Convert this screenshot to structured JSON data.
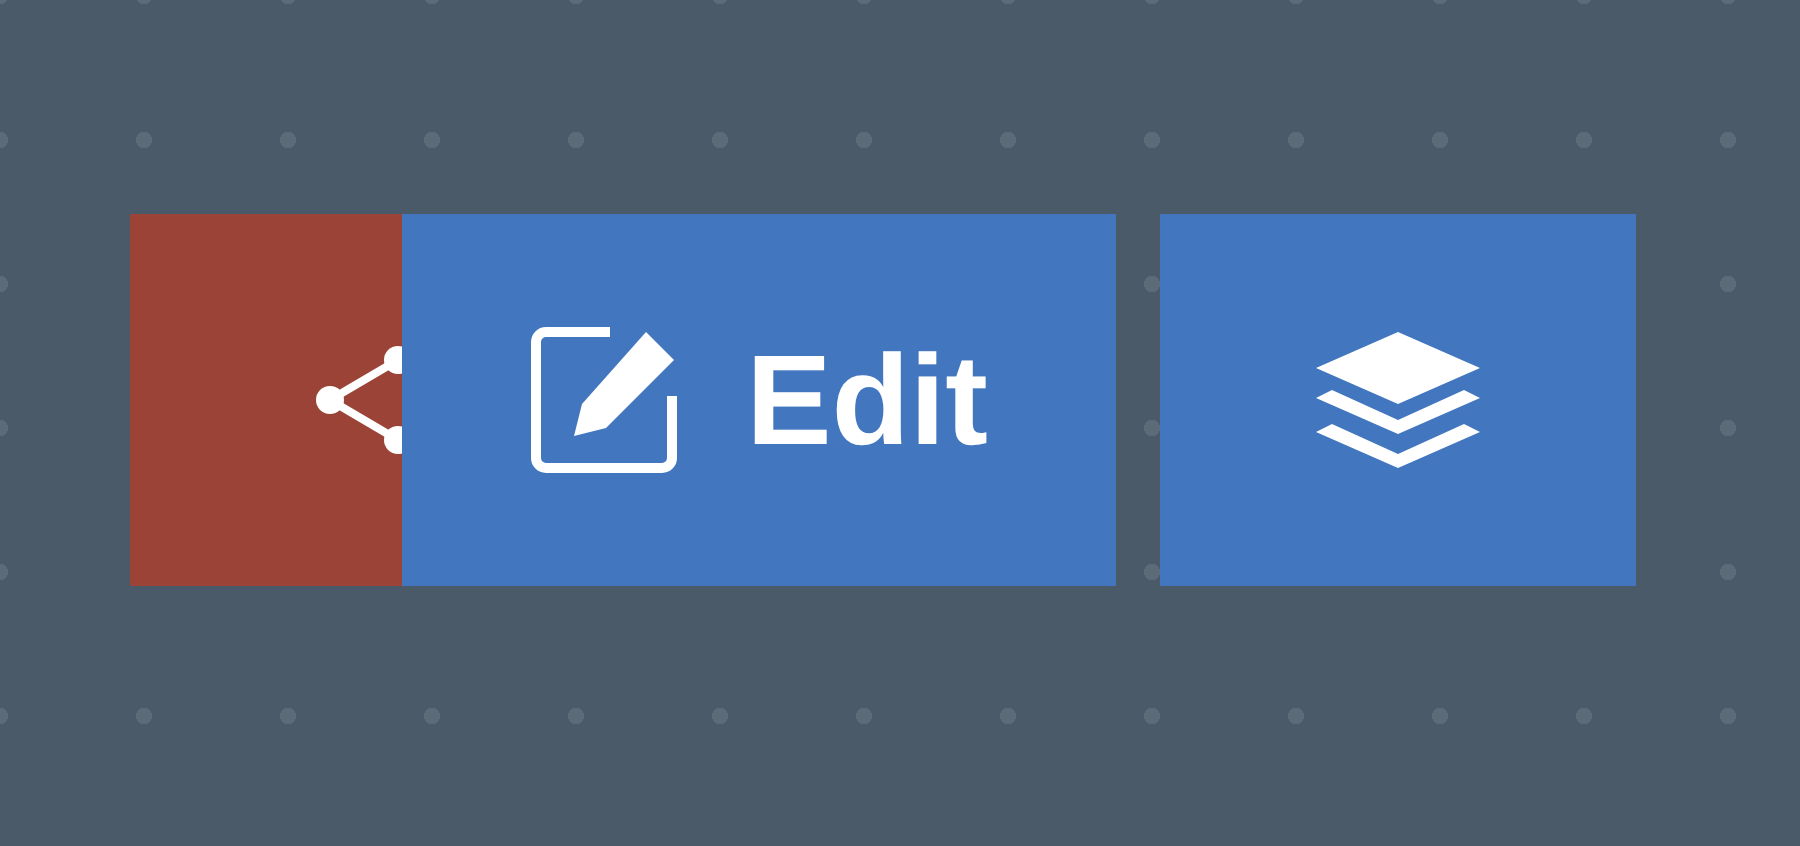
{
  "buttons": [
    {
      "kind": "share",
      "color": "#9b4336"
    },
    {
      "kind": "edit",
      "label": "Edit",
      "color": "#4276bf"
    },
    {
      "kind": "layers",
      "color": "#4276bf"
    }
  ]
}
